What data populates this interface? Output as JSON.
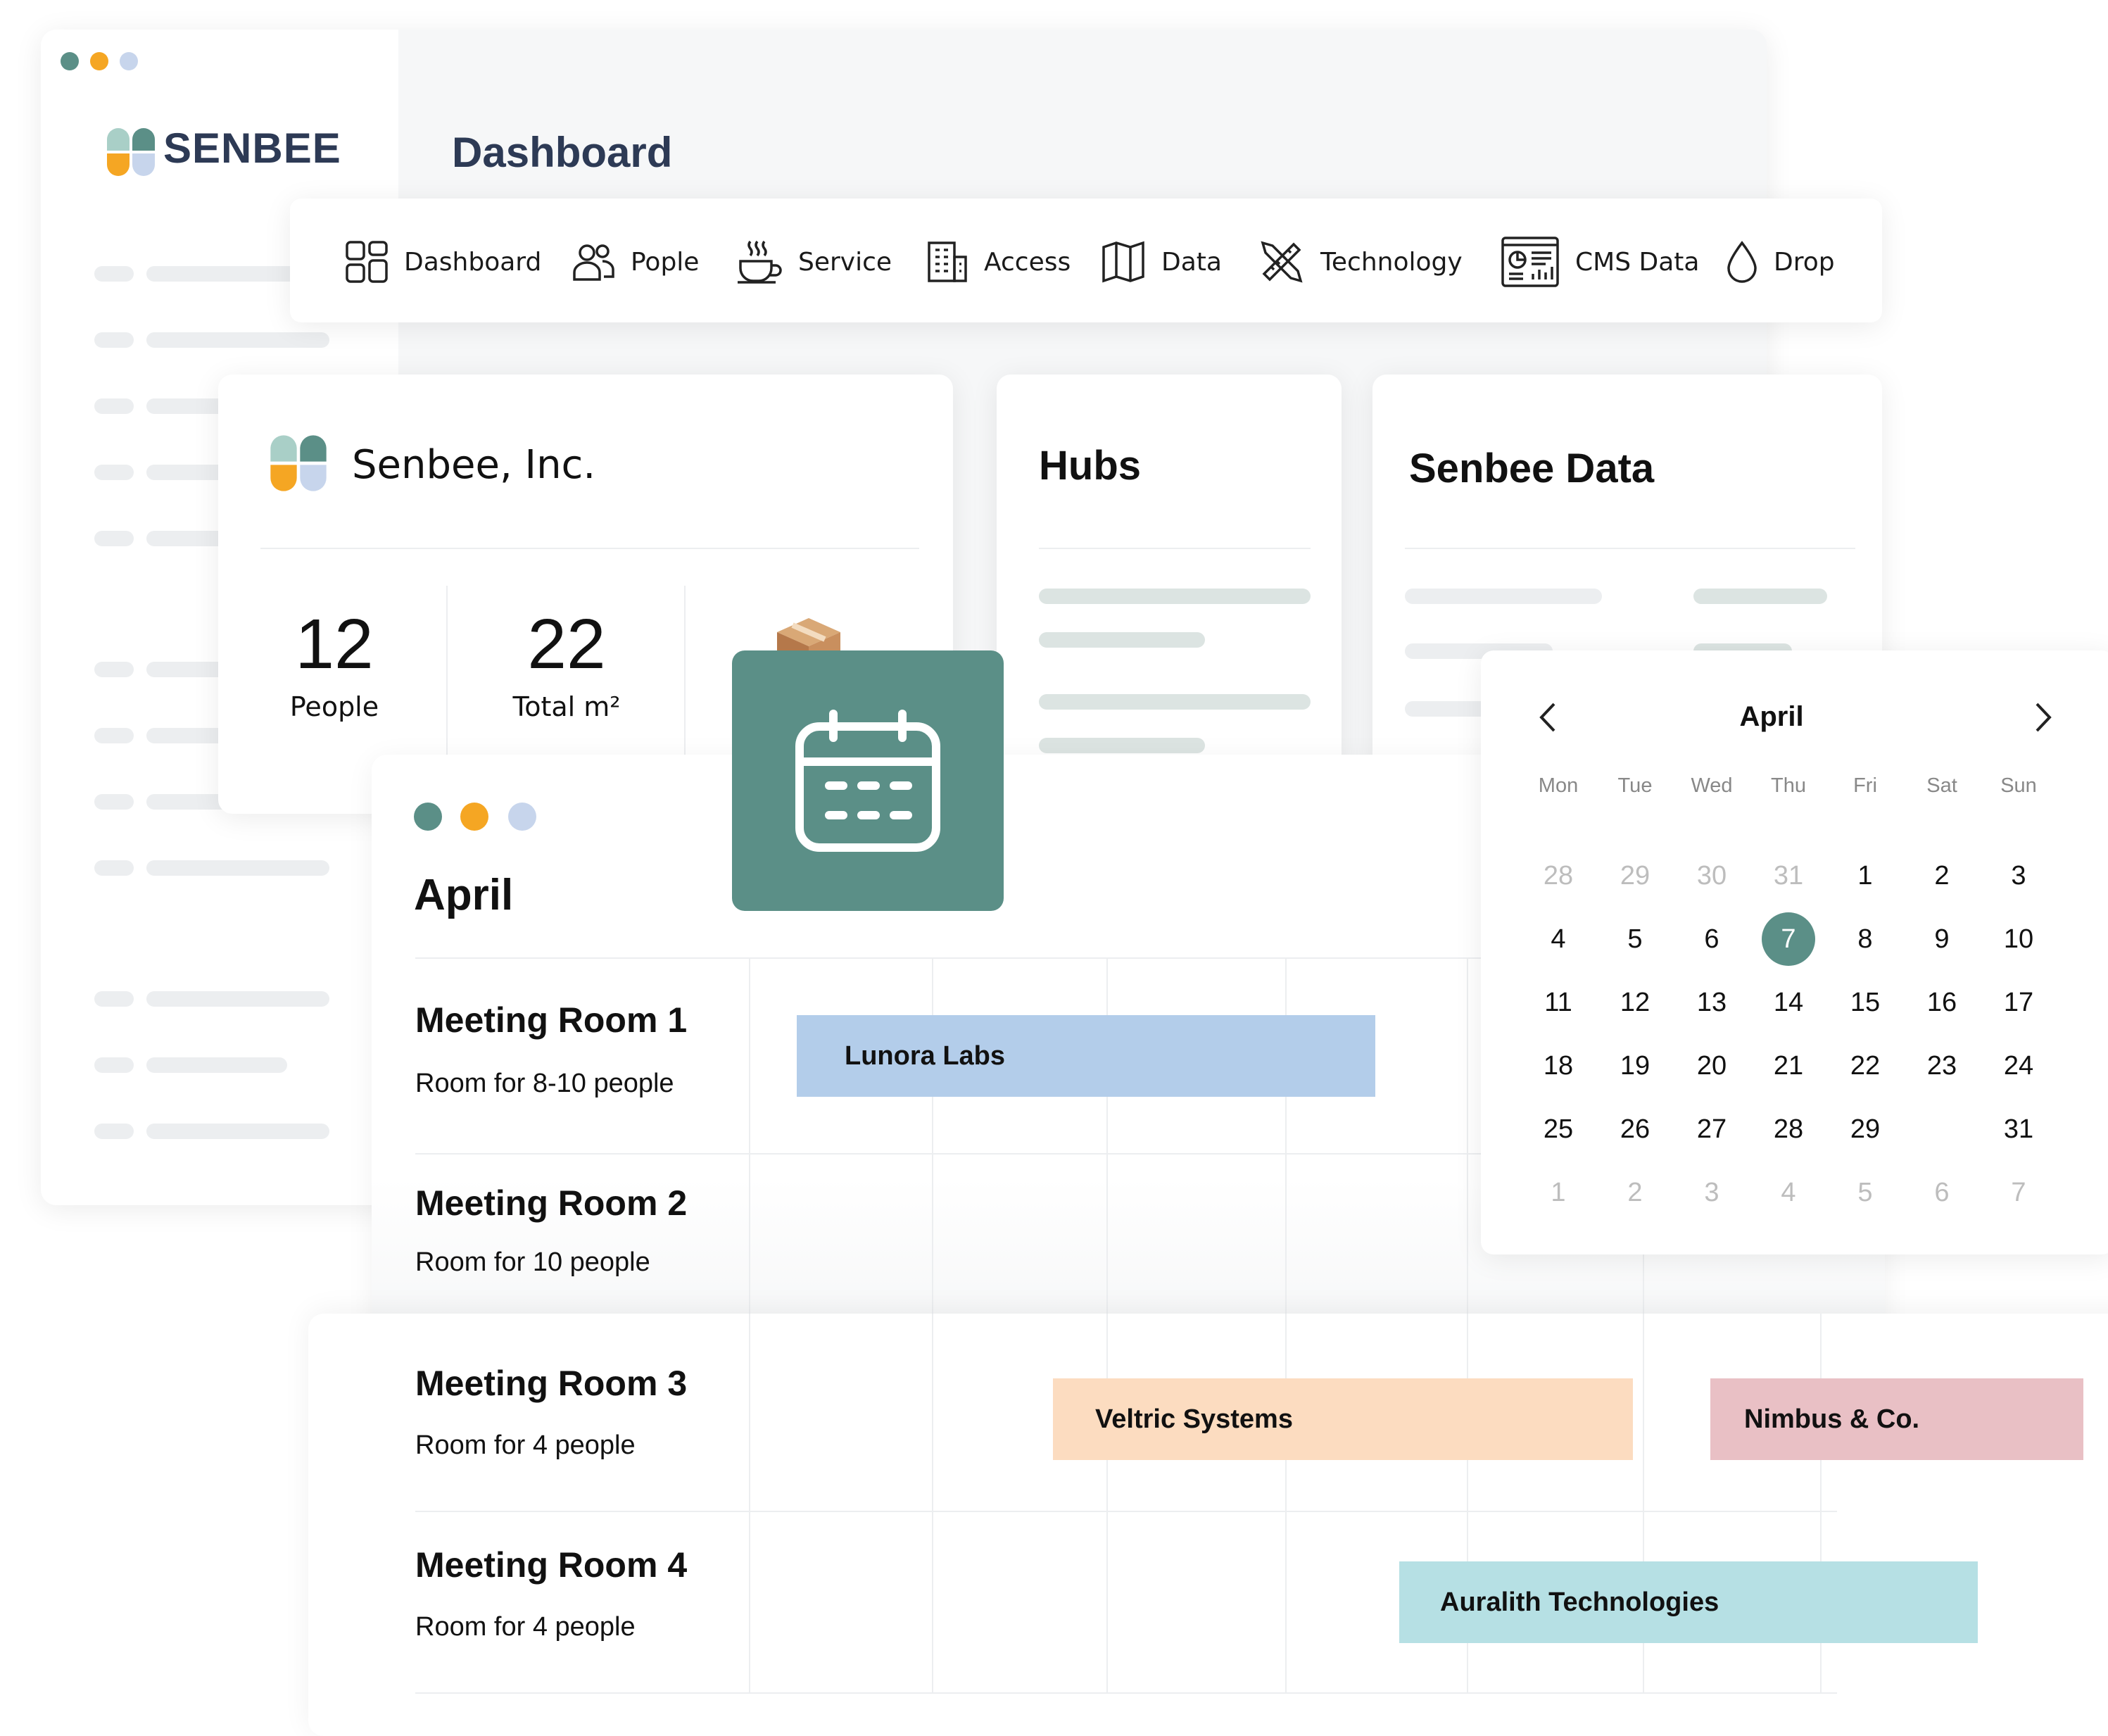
{
  "window": {
    "dots": [
      "#5b8f87",
      "#f5a623",
      "#c7d5ec"
    ]
  },
  "brand": {
    "name": "SENBEE",
    "colors": {
      "teal": "#5b8f87",
      "mint": "#a9cfc7",
      "orange": "#f5a623",
      "lavender": "#c7d5ec",
      "navy": "#2d3a55"
    }
  },
  "page": {
    "title": "Dashboard"
  },
  "nav": {
    "items": [
      {
        "label": "Dashboard",
        "icon": "grid-icon"
      },
      {
        "label": "Pople",
        "icon": "people-icon"
      },
      {
        "label": "Service",
        "icon": "coffee-icon"
      },
      {
        "label": "Access",
        "icon": "building-icon"
      },
      {
        "label": "Data",
        "icon": "map-icon"
      },
      {
        "label": "Technology",
        "icon": "tools-icon"
      },
      {
        "label": "CMS Data",
        "icon": "chart-dashboard-icon"
      },
      {
        "label": "Drop",
        "icon": "drop-icon"
      }
    ]
  },
  "company": {
    "name": "Senbee, Inc.",
    "stats": [
      {
        "value": "12",
        "label": "People"
      },
      {
        "value": "22",
        "label": "Total m²"
      }
    ],
    "extra_icon": "package-icon"
  },
  "hubs": {
    "title": "Hubs"
  },
  "senbee_data": {
    "title": "Senbee Data"
  },
  "calendar_badge": {
    "icon": "calendar-icon",
    "color": "#5b8f87"
  },
  "schedule": {
    "month": "April",
    "rooms": [
      {
        "name": "Meeting Room 1",
        "desc": "Room for 8-10 people"
      },
      {
        "name": "Meeting Room 2",
        "desc": "Room for 10 people"
      },
      {
        "name": "Meeting Room 3",
        "desc": "Room for 4 people"
      },
      {
        "name": "Meeting Room 4",
        "desc": "Room for 4 people"
      }
    ],
    "bookings": [
      {
        "label": "Lunora Labs",
        "color": "#b3cdea"
      },
      {
        "label": "Veltric Systems",
        "color": "#fcdcc0"
      },
      {
        "label": "Nimbus & Co.",
        "color": "#e9c0c5"
      },
      {
        "label": "Auralith Technologies",
        "color": "#b6e0e4"
      }
    ]
  },
  "calendar": {
    "month": "April",
    "prev_icon": "chevron-left-icon",
    "next_icon": "chevron-right-icon",
    "weekdays": [
      "Mon",
      "Tue",
      "Wed",
      "Thu",
      "Fri",
      "Sat",
      "Sun"
    ],
    "selected_color": "#5b8f87",
    "weeks": [
      [
        {
          "d": "28",
          "muted": true
        },
        {
          "d": "29",
          "muted": true
        },
        {
          "d": "30",
          "muted": true
        },
        {
          "d": "31",
          "muted": true
        },
        {
          "d": "1"
        },
        {
          "d": "2"
        },
        {
          "d": "3"
        }
      ],
      [
        {
          "d": "4"
        },
        {
          "d": "5"
        },
        {
          "d": "6"
        },
        {
          "d": "7",
          "selected": true
        },
        {
          "d": "8"
        },
        {
          "d": "9"
        },
        {
          "d": "10"
        }
      ],
      [
        {
          "d": "11"
        },
        {
          "d": "12"
        },
        {
          "d": "13"
        },
        {
          "d": "14"
        },
        {
          "d": "15"
        },
        {
          "d": "16"
        },
        {
          "d": "17"
        }
      ],
      [
        {
          "d": "18"
        },
        {
          "d": "19"
        },
        {
          "d": "20"
        },
        {
          "d": "21"
        },
        {
          "d": "22"
        },
        {
          "d": "23"
        },
        {
          "d": "24"
        }
      ],
      [
        {
          "d": "25"
        },
        {
          "d": "26"
        },
        {
          "d": "27"
        },
        {
          "d": "28"
        },
        {
          "d": "29"
        },
        {
          "d": ""
        },
        {
          "d": "31"
        }
      ],
      [
        {
          "d": "1",
          "muted": true
        },
        {
          "d": "2",
          "muted": true
        },
        {
          "d": "3",
          "muted": true
        },
        {
          "d": "4",
          "muted": true
        },
        {
          "d": "5",
          "muted": true
        },
        {
          "d": "6",
          "muted": true
        },
        {
          "d": "7",
          "muted": true
        }
      ]
    ]
  }
}
